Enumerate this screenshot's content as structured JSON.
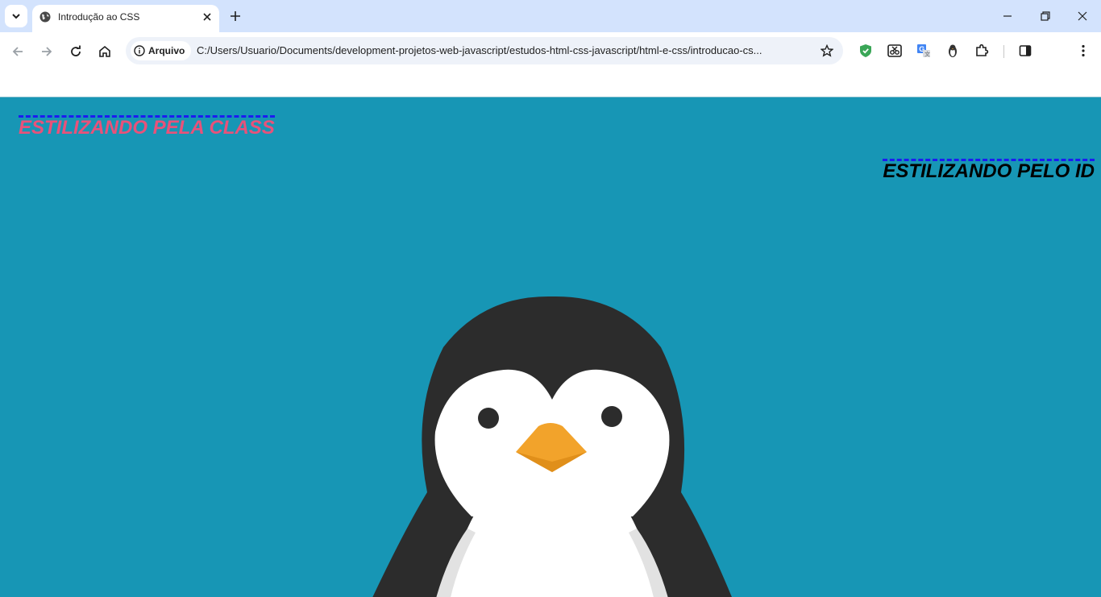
{
  "browser": {
    "tab": {
      "title": "Introdução ao CSS"
    },
    "toolbar": {
      "security_chip": "Arquivo",
      "url": "C:/Users/Usuario/Documents/development-projetos-web-javascript/estudos-html-css-javascript/html-e-css/introducao-cs..."
    },
    "icons": [
      "tab-search-icon",
      "globe-icon",
      "close-icon",
      "plus-icon",
      "minimize-icon",
      "restore-icon",
      "close-window-icon",
      "back-icon",
      "forward-icon",
      "reload-icon",
      "home-icon",
      "info-icon",
      "star-icon",
      "shield-extension-icon",
      "scissors-extension-icon",
      "translate-extension-icon",
      "penguin-extension-icon",
      "extensions-puzzle-icon",
      "side-panel-icon",
      "kebab-menu-icon"
    ]
  },
  "page": {
    "heading_class": "ESTILIZANDO PELA CLASS",
    "heading_id": "ESTILIZANDO PELO ID",
    "colors": {
      "background": "#1796b5",
      "class_heading": "#e8527a",
      "id_heading": "#000000",
      "dashed_border": "#1c1cf0"
    }
  }
}
